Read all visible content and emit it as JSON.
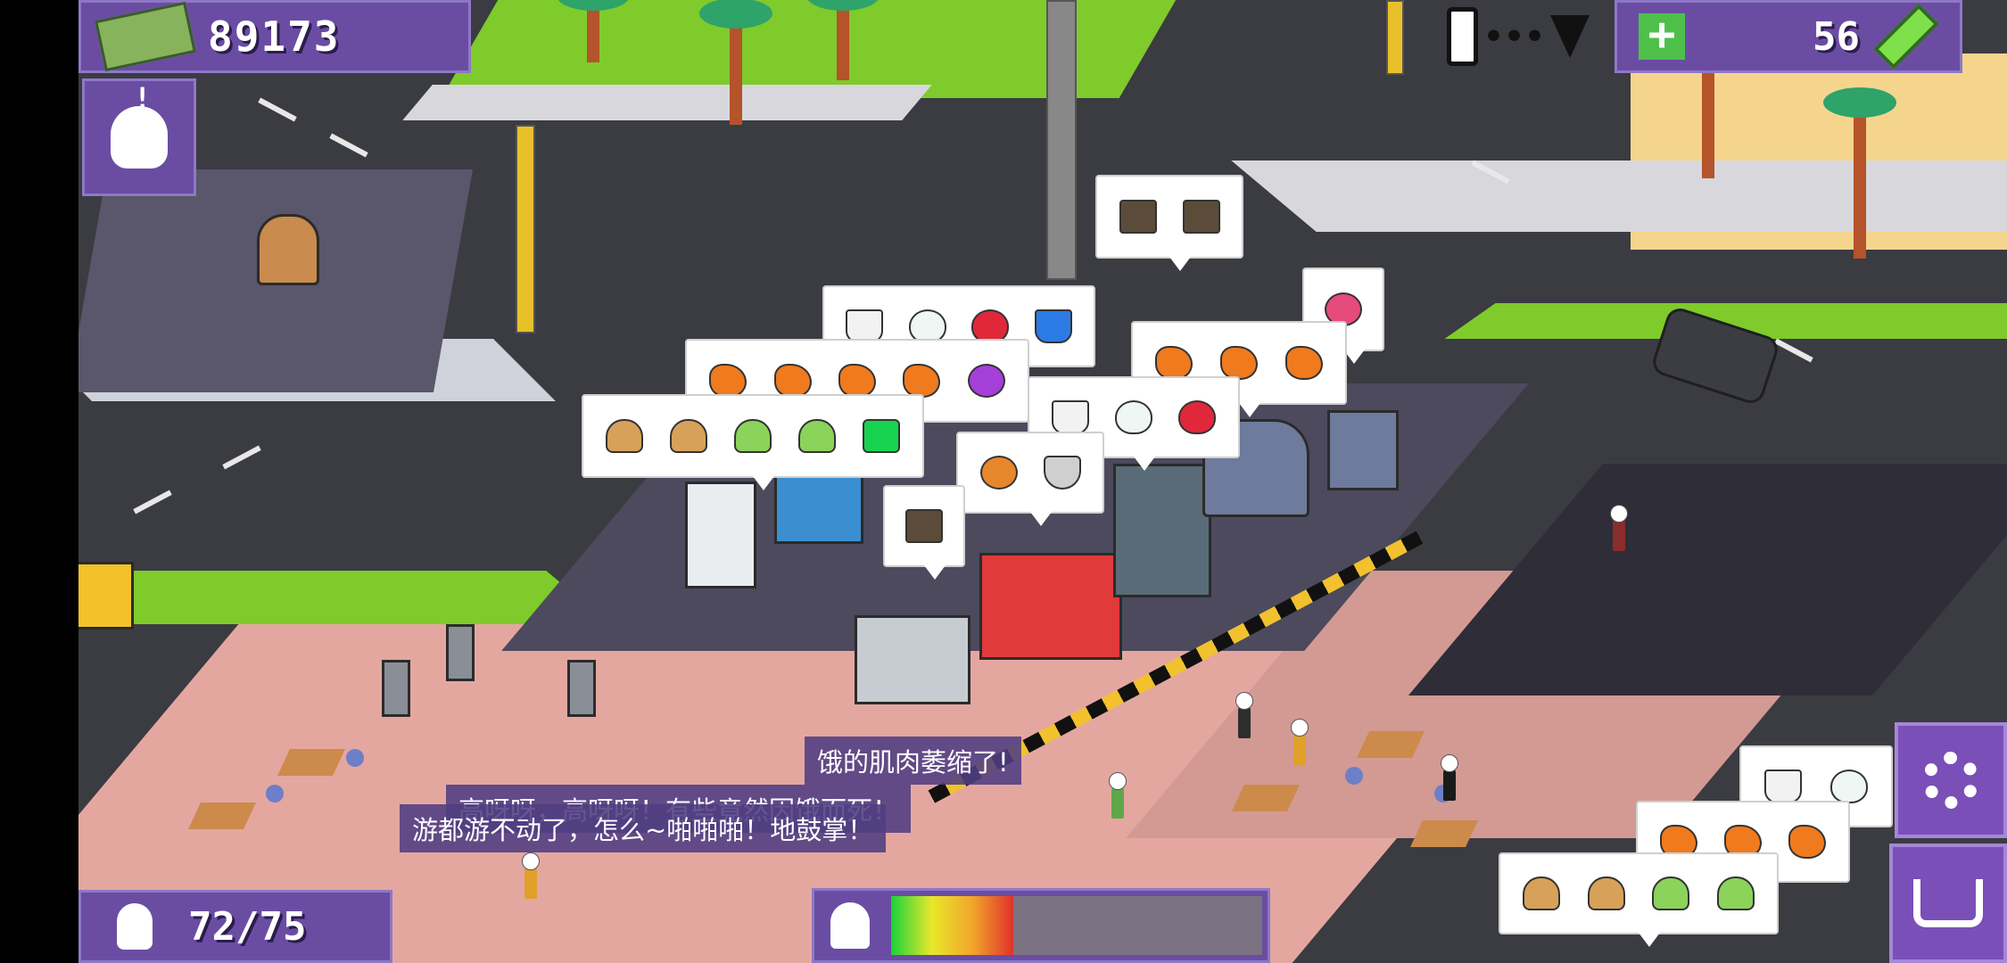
{
  "hud": {
    "money": "89173",
    "energy": "56",
    "visitors": "72/75",
    "mood_level": 0.33
  },
  "icons": {
    "money": "cash-stack-icon",
    "alert_avatar": "alert-avatar-icon",
    "signal": "signal-status-icon",
    "add_energy": "plus-icon",
    "battery": "battery-icon",
    "visitor": "visitor-head-icon",
    "mood": "ghost-mood-icon",
    "settings": "gear-icon",
    "shop": "shopping-cart-icon"
  },
  "speech": {
    "line1": "饿的肌肉萎缩了!",
    "line2": "高呀呀，高呀呀！有些竟然因饿而死！",
    "line3": "游都游不动了，怎么~啪啪啪！地鼓掌！"
  },
  "bubbles": [
    {
      "items": [
        "box",
        "box"
      ]
    },
    {
      "items": [
        "cup",
        "egg",
        "egg-r",
        "cup-b"
      ]
    },
    {
      "items": [
        "bird"
      ]
    },
    {
      "items": [
        "chick",
        "chick",
        "chick",
        "chick",
        "grape"
      ]
    },
    {
      "items": [
        "chick",
        "chick",
        "chick"
      ]
    },
    {
      "items": [
        "burger",
        "burger",
        "burger-g",
        "burger-g",
        "gem"
      ]
    },
    {
      "items": [
        "cup",
        "egg",
        "egg-r"
      ]
    },
    {
      "items": [
        "pie",
        "bowl"
      ]
    },
    {
      "items": [
        "box"
      ]
    },
    {
      "items": [
        "cup",
        "egg"
      ]
    },
    {
      "items": [
        "chick",
        "chick",
        "chick"
      ]
    },
    {
      "items": [
        "burger",
        "burger",
        "burger-g",
        "burger-g"
      ]
    }
  ],
  "colors": {
    "hud_panel": "#6a4da3",
    "grass": "#7ecb2b",
    "road": "#3b3b42",
    "floor": "#e4a7a0"
  }
}
